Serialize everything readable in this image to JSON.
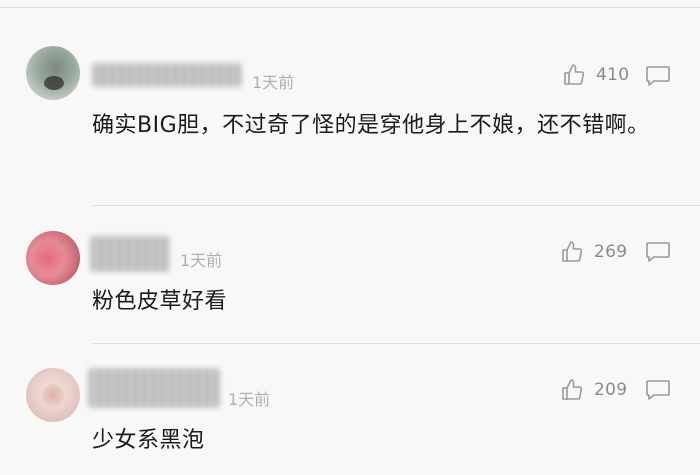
{
  "comments": [
    {
      "time": "1天前",
      "likes": "410",
      "text": "确实BIG胆，不过奇了怪的是穿他身上不娘，还不错啊。",
      "icons": {
        "avatar": "avatar-icon",
        "like": "thumbs-up-icon",
        "reply": "comment-icon"
      }
    },
    {
      "time": "1天前",
      "likes": "269",
      "text": "粉色皮草好看",
      "icons": {
        "avatar": "avatar-icon",
        "like": "thumbs-up-icon",
        "reply": "comment-icon"
      }
    },
    {
      "time": "1天前",
      "likes": "209",
      "text": "少女系黑泡",
      "icons": {
        "avatar": "avatar-icon",
        "like": "thumbs-up-icon",
        "reply": "comment-icon"
      }
    }
  ],
  "colors": {
    "background": "#f8f8f8",
    "text": "#1a1a1a",
    "meta": "#b0b0b0",
    "count": "#8a8a8a",
    "divider": "#e2e2e2"
  }
}
